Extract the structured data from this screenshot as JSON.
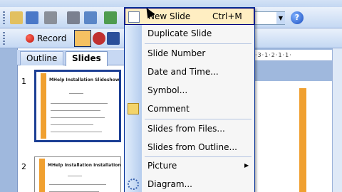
{
  "toolbar": {
    "record_label": "Record",
    "help_glyph": "?"
  },
  "left_pane": {
    "tabs": [
      {
        "label": "Outline"
      },
      {
        "label": "Slides"
      }
    ],
    "slides": [
      {
        "number": "1",
        "title": "MHelp Installation Slideshow"
      },
      {
        "number": "2",
        "title": "MHelp Installation Installation"
      }
    ]
  },
  "ruler": {
    "text": "·3·1·2·1·1·"
  },
  "insert_menu": {
    "items": [
      {
        "label": "New Slide",
        "shortcut": "Ctrl+M",
        "icon": "new-slide-icon"
      },
      {
        "label": "Duplicate Slide"
      },
      {
        "label": "Slide Number"
      },
      {
        "label": "Date and Time..."
      },
      {
        "label": "Symbol..."
      },
      {
        "label": "Comment",
        "icon": "comment-icon"
      },
      {
        "label": "Slides from Files..."
      },
      {
        "label": "Slides from Outline..."
      },
      {
        "label": "Picture",
        "has_submenu": true
      },
      {
        "label": "Diagram...",
        "icon": "diagram-icon"
      }
    ],
    "submenu_arrow": "▶"
  },
  "colors": {
    "menu_hover": "#ffeec2",
    "menu_border": "#002d96",
    "slide_accent": "#f0a030",
    "selection_border": "#1c3f94"
  }
}
